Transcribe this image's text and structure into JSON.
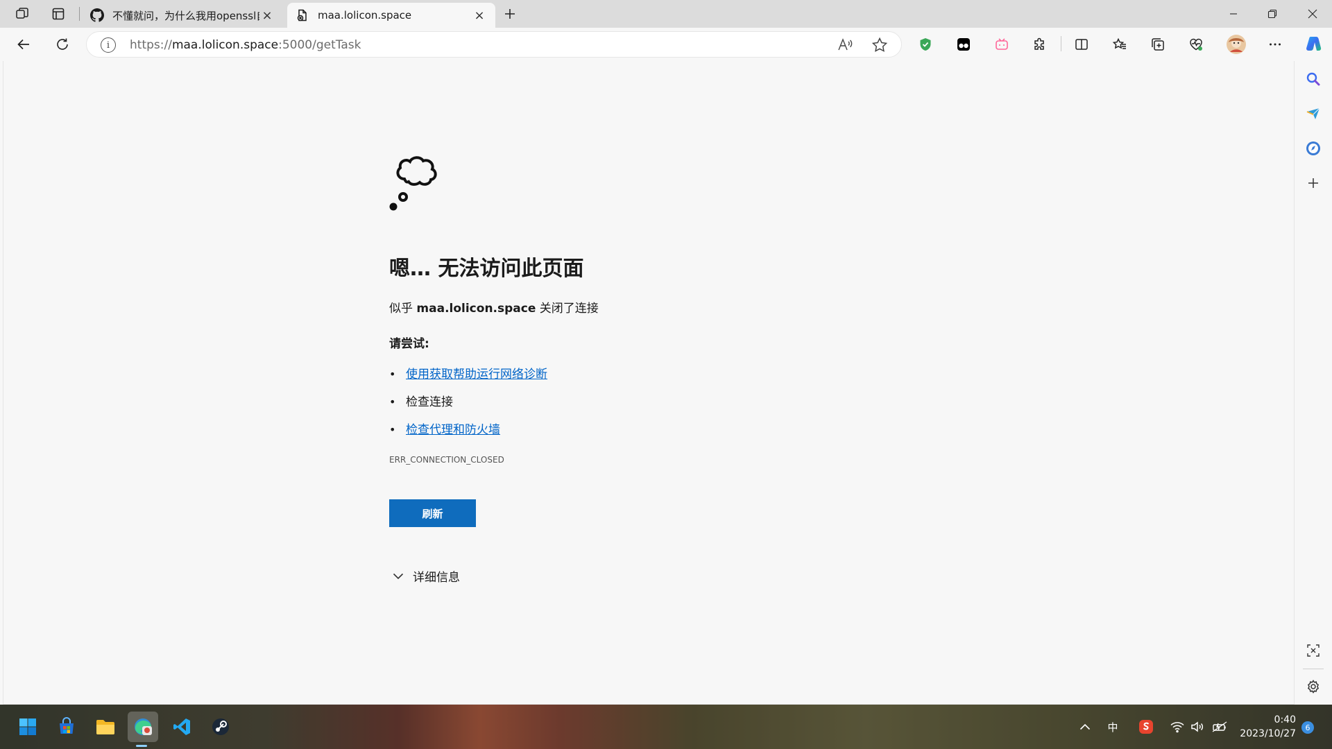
{
  "tabs": [
    {
      "title": "不懂就问，为什么我用openssl自",
      "close": "×"
    },
    {
      "title": "maa.lolicon.space",
      "close": "×"
    }
  ],
  "address": {
    "scheme": "https://",
    "host": "maa.lolicon.space",
    "rest": ":5000/getTask"
  },
  "error": {
    "title": "嗯… 无法访问此页面",
    "desc_prefix": "似乎 ",
    "desc_host": "maa.lolicon.space",
    "desc_suffix": " 关闭了连接",
    "try_label": "请尝试:",
    "suggestions": [
      {
        "text": "使用获取帮助运行网络诊断",
        "link": true
      },
      {
        "text": "检查连接",
        "link": false
      },
      {
        "text": "检查代理和防火墙",
        "link": true
      }
    ],
    "code": "ERR_CONNECTION_CLOSED",
    "reload_label": "刷新",
    "details_label": "详细信息"
  },
  "taskbar": {
    "ime": "中",
    "time": "0:40",
    "date": "2023/10/27",
    "notifications": "6"
  },
  "colors": {
    "accent": "#0f6cbd",
    "link": "#0064c8"
  }
}
